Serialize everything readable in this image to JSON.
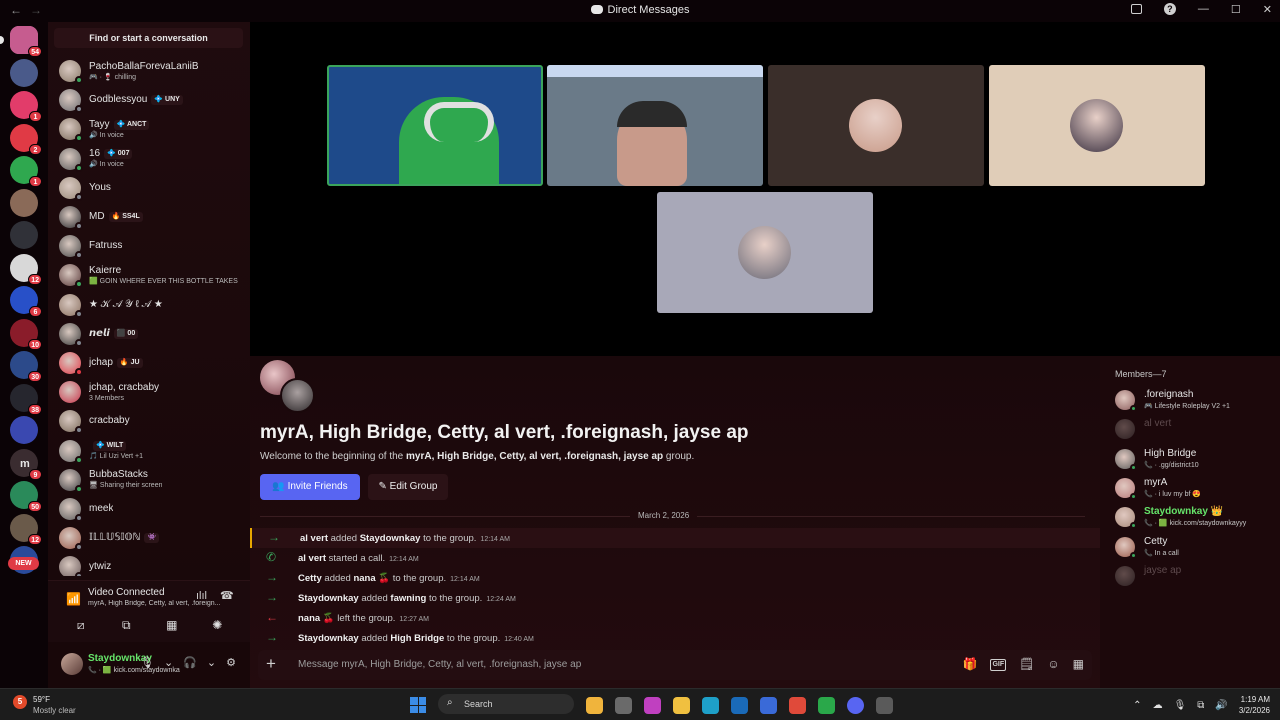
{
  "window": {
    "title": "Direct Messages",
    "nav_back": "←",
    "nav_forward": "→",
    "minimize": "—",
    "maximize": "☐",
    "close": "✕",
    "help": "?"
  },
  "servers": [
    {
      "badge": "54",
      "color": "#c65c8f"
    },
    {
      "badge": "",
      "color": "#4a5a8a"
    },
    {
      "badge": "1",
      "color": "#e23c6a"
    },
    {
      "badge": "2",
      "color": "#e03a45"
    },
    {
      "badge": "1",
      "color": "#2fa84f"
    },
    {
      "badge": "",
      "color": "#8a6a58"
    },
    {
      "badge": "",
      "color": "#303138"
    },
    {
      "badge": "12",
      "color": "#d8d8d8"
    },
    {
      "badge": "6",
      "color": "#2850c8"
    },
    {
      "badge": "10",
      "color": "#8a1c2a"
    },
    {
      "badge": "30",
      "color": "#2c4a8a"
    },
    {
      "badge": "38",
      "color": "#26262e"
    },
    {
      "badge": "",
      "color": "#3a48b0"
    },
    {
      "badge": "9",
      "color": "#3a2c30"
    },
    {
      "badge": "50",
      "color": "#2a8a5a"
    },
    {
      "badge": "12",
      "color": "#6a5a4a"
    },
    {
      "badge": "",
      "color": "#2a4a9a"
    }
  ],
  "rail_letter": "m",
  "rail_new": "NEW",
  "sidebar": {
    "search_label": "Find or start a conversation",
    "dms": [
      {
        "name": "PachoBallaForevaLaniiB",
        "sub": "🎮 · 🍷 chilling",
        "tag": "",
        "color": "#8a7a6a",
        "status": "online"
      },
      {
        "name": "Godblessyou",
        "sub": "",
        "tag": "💠 UNY",
        "color": "#6a6a6e",
        "status": "off"
      },
      {
        "name": "Tayy",
        "sub": "🔊 In voice",
        "tag": "💠 ANCT",
        "color": "#7a6a5a",
        "status": "online"
      },
      {
        "name": "16",
        "sub": "🔊 In voice",
        "tag": "💠 007",
        "color": "#5a5a5a",
        "status": "online"
      },
      {
        "name": "Yous",
        "sub": "",
        "tag": "",
        "color": "#9a8a7a",
        "status": "off"
      },
      {
        "name": "MD",
        "sub": "",
        "tag": "🔥 SS4L",
        "color": "#2a2a2e",
        "status": "off"
      },
      {
        "name": "Fatruss",
        "sub": "",
        "tag": "",
        "color": "#4a4a4a",
        "status": "off"
      },
      {
        "name": "Kaierre",
        "sub": "🟩 GOIN WHERE EVER THIS BOTTLE TAKES",
        "tag": "",
        "color": "#5a3a3a",
        "status": "online"
      },
      {
        "name": "★ 𝒦 𝒜 𝒴 ℓ 𝒜 ★",
        "sub": "",
        "tag": "",
        "color": "#8a7060",
        "status": "off"
      },
      {
        "name": "𝙣𝙚𝙡𝙞",
        "sub": "",
        "tag": "⬛ 00",
        "color": "#3a3a3a",
        "status": "off"
      },
      {
        "name": "jchap",
        "sub": "",
        "tag": "🔥 JU",
        "color": "#e23c4a",
        "status": "dnd"
      },
      {
        "name": "jchap, cracbaby",
        "sub": "3 Members",
        "tag": "",
        "color": "#c8344a",
        "status": ""
      },
      {
        "name": "cracbaby",
        "sub": "",
        "tag": "",
        "color": "#7a6a5a",
        "status": "off"
      },
      {
        "name": "",
        "sub": "🎵 Lil Uzi Vert +1",
        "tag": "💠 WILT",
        "color": "#6a6a6a",
        "status": "online"
      },
      {
        "name": "BubbaStacks",
        "sub": "🖥 Sharing their screen",
        "tag": "",
        "color": "#3a3a3e",
        "status": "online"
      },
      {
        "name": "meek",
        "sub": "",
        "tag": "",
        "color": "#5a5a5a",
        "status": "off"
      },
      {
        "name": "𝕀𝕃𝕃𝕌𝕊𝕀𝕆ℕ",
        "sub": "",
        "tag": "👾",
        "color": "#9a5a4a",
        "status": "off"
      },
      {
        "name": "ytwiz",
        "sub": "",
        "tag": "",
        "color": "#6a5a5a",
        "status": "off"
      }
    ]
  },
  "voice": {
    "title": "Video Connected",
    "channel": "myrA, High Bridge, Cetty, al vert, .foreign...",
    "signal": "📶",
    "eq": "ılıl",
    "hang": "☎",
    "buttons": [
      "⧄",
      "⧉",
      "▦",
      "✺"
    ]
  },
  "user": {
    "name": "Staydownkay",
    "status": "📞 · 🟩 kick.com/staydownkayyy",
    "mic": "🎙",
    "headset": "🎧",
    "settings": "⚙",
    "caret": "⌄"
  },
  "tiles": [
    {
      "id": "tile-1",
      "bg": "#1e4a8a",
      "avatar_color": ""
    },
    {
      "id": "tile-2",
      "bg": "#6a7a88",
      "avatar_color": ""
    },
    {
      "id": "tile-3",
      "bg": "#3a2e2a",
      "avatar_color": "#c89a88"
    },
    {
      "id": "tile-4",
      "bg": "#e0cdb8",
      "avatar_color": "#3a3040"
    },
    {
      "id": "tile-5",
      "bg": "#a8a8b8",
      "avatar_color": "#6a6a78"
    }
  ],
  "group": {
    "title": "myrA, High Bridge, Cetty, al vert, .foreignash, jayse ap",
    "welcome_prefix": "Welcome to the beginning of the",
    "welcome_names": "myrA, High Bridge, Cetty, al vert, .foreignash, jayse ap",
    "welcome_suffix": "group.",
    "invite_label": "Invite Friends",
    "edit_label": "Edit Group"
  },
  "date_divider": "March 2, 2026",
  "messages": [
    {
      "actor": "al vert",
      "action": "added",
      "target": "Staydownkay",
      "rest": "to the group.",
      "time": "12:14 AM",
      "kind": "join",
      "highlight": true
    },
    {
      "actor": "al vert",
      "action": "started a call.",
      "target": "",
      "rest": "",
      "time": "12:14 AM",
      "kind": "call",
      "highlight": false
    },
    {
      "actor": "Cetty",
      "action": "added",
      "target": "nana 🍒",
      "rest": "to the group.",
      "time": "12:14 AM",
      "kind": "join",
      "highlight": false
    },
    {
      "actor": "Staydownkay",
      "action": "added",
      "target": "fawning",
      "rest": "to the group.",
      "time": "12:24 AM",
      "kind": "join",
      "highlight": false
    },
    {
      "actor": "nana 🍒",
      "action": "left the group.",
      "target": "",
      "rest": "",
      "time": "12:27 AM",
      "kind": "leave",
      "highlight": false
    },
    {
      "actor": "Staydownkay",
      "action": "added",
      "target": "High Bridge",
      "rest": "to the group.",
      "time": "12:40 AM",
      "kind": "join",
      "highlight": false
    }
  ],
  "composer": {
    "placeholder": "Message myrA, High Bridge, Cetty, al vert, .foreignash, jayse ap",
    "plus": "+",
    "icons": [
      "🎁",
      "GIF",
      "🗒",
      "☺",
      "▦"
    ]
  },
  "members": {
    "header": "Members—7",
    "list": [
      {
        "name": ".foreignash",
        "sub": "🎮 Lifestyle Roleplay V2 +1",
        "color": "#8a5a5a",
        "dim": false,
        "green": false
      },
      {
        "name": "al vert",
        "sub": "",
        "color": "#4a4a4a",
        "dim": true,
        "green": false
      },
      {
        "name": "High Bridge",
        "sub": "📞 · .gg/district10",
        "color": "#5a5a5a",
        "dim": false,
        "green": false
      },
      {
        "name": "myrA",
        "sub": "📞 · i luv my bf 😍",
        "color": "#b87a7a",
        "dim": false,
        "green": false
      },
      {
        "name": "Staydownkay 👑",
        "sub": "📞 · 🟩 kick.com/staydownkayyy",
        "color": "#a88a7a",
        "dim": false,
        "green": true
      },
      {
        "name": "Cetty",
        "sub": "📞 In a call",
        "color": "#9a5a4a",
        "dim": false,
        "green": false
      },
      {
        "name": "jayse ap",
        "sub": "",
        "color": "#4a4a4a",
        "dim": true,
        "green": false
      }
    ]
  },
  "taskbar": {
    "weather_badge": "5",
    "temp": "59°F",
    "weather": "Mostly clear",
    "search_label": "Search",
    "time": "1:19 AM",
    "date": "3/2/2026",
    "tray": [
      "⌃",
      "☁",
      "🎙",
      "⧉",
      "🔊"
    ],
    "apps": [
      "#f0b43c",
      "#6a6a6a",
      "#c040c0",
      "#f0c040",
      "#1ea0c8",
      "#1a6ab8",
      "#3a6ad8",
      "#e04a3a",
      "#2aa84a",
      "#5865f2",
      "#5a5a5a"
    ]
  }
}
